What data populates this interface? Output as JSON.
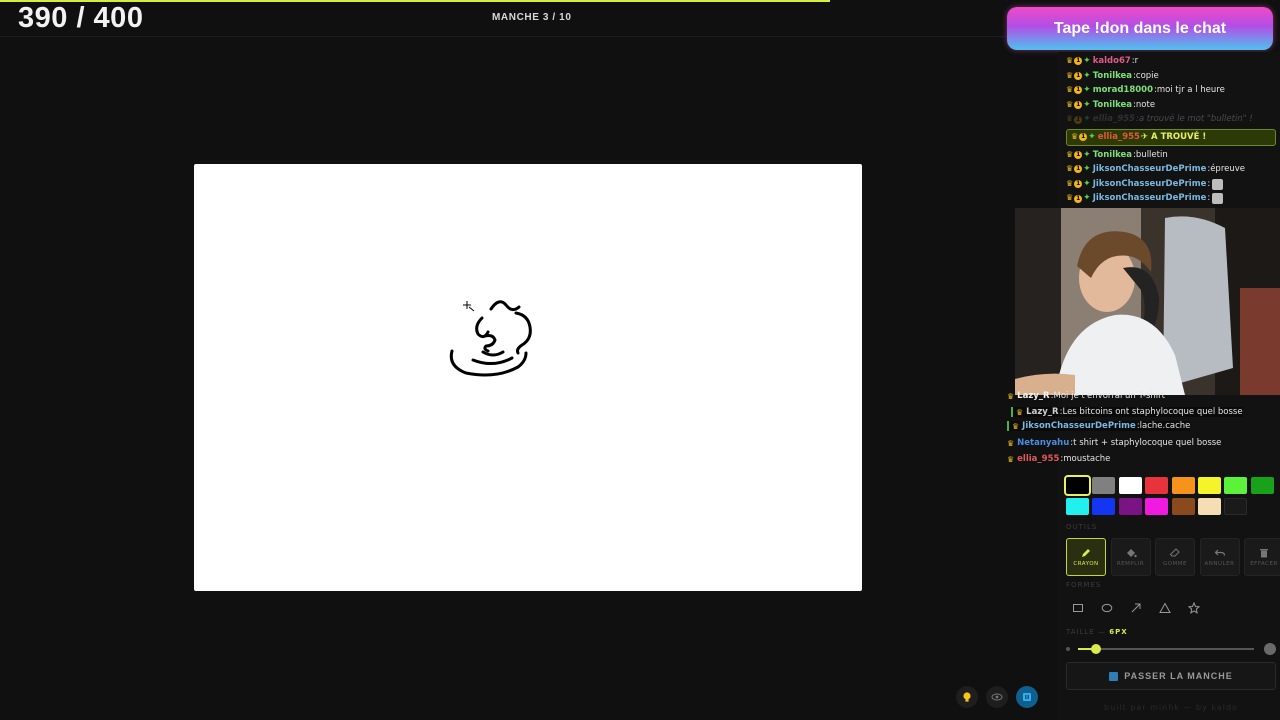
{
  "header": {
    "score": "390 / 400",
    "round": "MANCHE 3 / 10"
  },
  "banner": {
    "text": "Tape !don dans le chat"
  },
  "chat": [
    {
      "user": "kaldo67",
      "text": "r",
      "color": "#e05a8a",
      "faded": false
    },
    {
      "user": "Tonilkea",
      "text": "copie",
      "color": "#7fe07a",
      "faded": false
    },
    {
      "user": "morad18000",
      "text": "moi tjr a l heure",
      "color": "#7fe07a",
      "faded": false
    },
    {
      "user": "Tonilkea",
      "text": "note",
      "color": "#7fe07a",
      "faded": false
    },
    {
      "user": "ellia_955",
      "text": "a trouvé le mot \"bulletin\" !",
      "color": "#888888",
      "faded": true
    },
    {
      "user": "ellia_955",
      "text": "A TROUVÉ !",
      "color": "#e05a3a",
      "faded": false,
      "found": true
    },
    {
      "user": "Tonilkea",
      "text": "bulletin",
      "color": "#7fe07a",
      "faded": false
    },
    {
      "user": "JiksonChasseurDePrime",
      "text": "épreuve",
      "color": "#7ab8e0",
      "faded": false
    },
    {
      "user": "JiksonChasseurDePrime",
      "text": "",
      "color": "#7ab8e0",
      "faded": false,
      "emote": true
    },
    {
      "user": "JiksonChasseurDePrime",
      "text": "",
      "color": "#7ab8e0",
      "faded": false,
      "emote": true
    }
  ],
  "overlay_chat": [
    {
      "user": "Lazy_R",
      "text": "Moi je t'envorrai un T-shirt",
      "color": "#f2f2f2"
    },
    {
      "user": "Lazy_R",
      "text": "Les bitcoins ont staphylocoque quel bosse",
      "color": "#cfcfcf"
    },
    {
      "user": "JiksonChasseurDePrime",
      "text": "lache.cache",
      "color": "#7ab8e0"
    },
    {
      "user": "Netanyahu",
      "text": "t shirt + staphylocoque quel bosse",
      "color": "#4a8ee0"
    },
    {
      "user": "ellia_955",
      "text": "moustache",
      "color": "#e05a5a"
    }
  ],
  "palette": {
    "colors": [
      "#000000",
      "#808080",
      "#ffffff",
      "#e8323c",
      "#f7931a",
      "#f5f32a",
      "#5cf23a",
      "#1aa11a",
      "#22f0f0",
      "#1436f0",
      "#7a1485",
      "#f01ae0",
      "#8a4a1e",
      "#f5deb3",
      "#1a1a1a"
    ],
    "selected": 0
  },
  "labels": {
    "tools_section": "OUTILS",
    "shapes_section": "FORMES",
    "size_label": "TAILLE —",
    "size_value": "6PX"
  },
  "tools": [
    {
      "label": "CRAYON",
      "icon": "pencil-icon",
      "active": true
    },
    {
      "label": "REMPLIR",
      "icon": "bucket-icon",
      "active": false
    },
    {
      "label": "GOMME",
      "icon": "eraser-icon",
      "active": false
    },
    {
      "label": "ANNULER",
      "icon": "undo-icon",
      "active": false
    },
    {
      "label": "EFFACER",
      "icon": "trash-icon",
      "active": false
    }
  ],
  "shapes": [
    "rectangle-icon",
    "ellipse-icon",
    "arrow-icon",
    "triangle-icon",
    "star-icon"
  ],
  "brush_size": 0.1,
  "skip_button": "PASSER LA MANCHE",
  "credit": "built par minhk — by kaldo"
}
